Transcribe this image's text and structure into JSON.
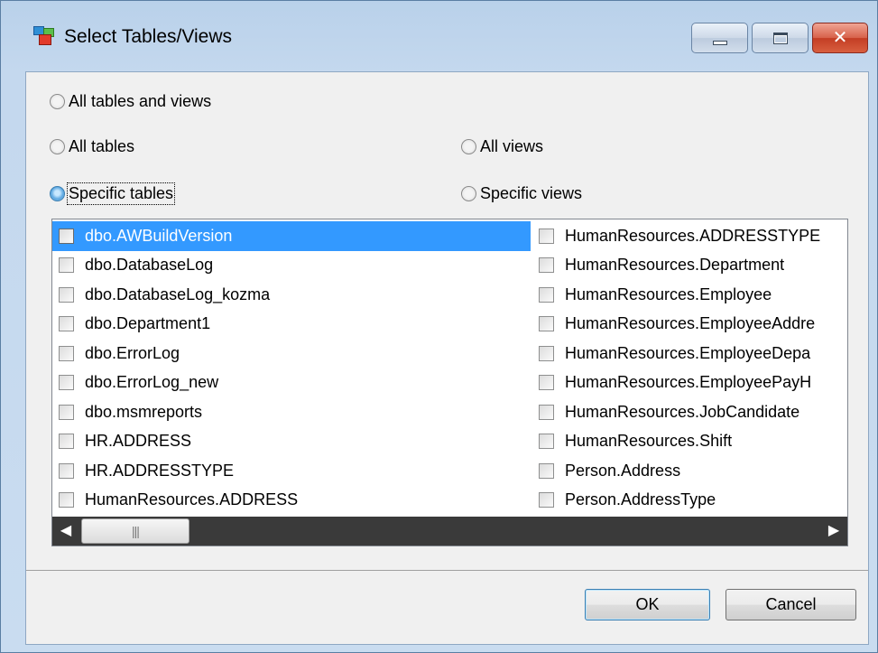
{
  "window": {
    "title": "Select Tables/Views",
    "controls": {
      "close_glyph": "✕"
    }
  },
  "options": {
    "all_tables_and_views": "All tables and views",
    "all_tables": "All tables",
    "all_views": "All views",
    "specific_tables": "Specific tables",
    "specific_views": "Specific views",
    "selected": "specific_tables"
  },
  "list": {
    "column1": [
      "dbo.AWBuildVersion",
      "dbo.DatabaseLog",
      "dbo.DatabaseLog_kozma",
      "dbo.Department1",
      "dbo.ErrorLog",
      "dbo.ErrorLog_new",
      "dbo.msmreports",
      "HR.ADDRESS",
      "HR.ADDRESSTYPE",
      "HumanResources.ADDRESS"
    ],
    "column2": [
      "HumanResources.ADDRESSTYPE",
      "HumanResources.Department",
      "HumanResources.Employee",
      "HumanResources.EmployeeAddre",
      "HumanResources.EmployeeDepa",
      "HumanResources.EmployeePayH",
      "HumanResources.JobCandidate",
      "HumanResources.Shift",
      "Person.Address",
      "Person.AddressType"
    ],
    "selected_item": "dbo.AWBuildVersion",
    "scroll_left_glyph": "◀",
    "scroll_right_glyph": "▶",
    "thumb_grip": "|||"
  },
  "buttons": {
    "ok": "OK",
    "cancel": "Cancel"
  },
  "colors": {
    "selection": "#3399ff",
    "scrollbar": "#3a3a3a",
    "close_button": "#c33e24"
  },
  "icons": {
    "app": "tables-views-app-icon"
  }
}
